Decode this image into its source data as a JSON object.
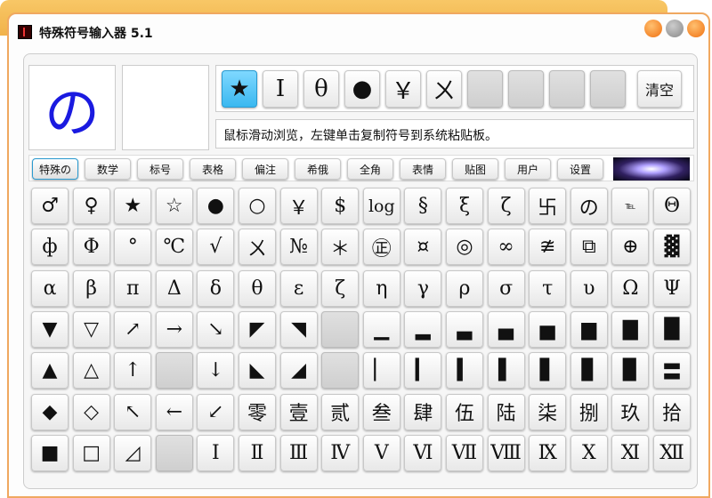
{
  "window": {
    "title": "特殊符号输入器 5.1"
  },
  "preview": {
    "symbol": "の"
  },
  "recent": [
    "★",
    "Ⅰ",
    "θ",
    "●",
    "￥",
    "ㄨ",
    "",
    "",
    "",
    ""
  ],
  "clear_label": "清空",
  "hint": "鼠标滑动浏览，左键单击复制符号到系统粘贴板。",
  "tabs": [
    "特殊の",
    "数学",
    "标号",
    "表格",
    "偏注",
    "希俄",
    "全角",
    "表情",
    "贴图",
    "用户",
    "设置"
  ],
  "grid": [
    [
      "♂",
      "♀",
      "★",
      "☆",
      "●",
      "○",
      "￥",
      "$",
      "log",
      "§",
      "ξ",
      "ζ",
      "卐",
      "の",
      "℡",
      "Θ"
    ],
    [
      "ф",
      "Φ",
      "°",
      "℃",
      "√",
      "ㄨ",
      "№",
      "＊",
      "㊣",
      "¤",
      "◎",
      "∞",
      "≇",
      "⧉",
      "⊕",
      "▓"
    ],
    [
      "α",
      "β",
      "π",
      "Δ",
      "δ",
      "θ",
      "ε",
      "ζ",
      "η",
      "γ",
      "ρ",
      "σ",
      "τ",
      "υ",
      "Ω",
      "Ψ"
    ],
    [
      "▼",
      "▽",
      "↗",
      "→",
      "↘",
      "◤",
      "◥",
      "",
      "▁",
      "▂",
      "▃",
      "▄",
      "▅",
      "▆",
      "▇",
      "█"
    ],
    [
      "▲",
      "△",
      "↑",
      "",
      "↓",
      "◣",
      "◢",
      "",
      "▏",
      "▎",
      "▍",
      "▌",
      "▋",
      "▊",
      "▉",
      "〓"
    ],
    [
      "◆",
      "◇",
      "↖",
      "←",
      "↙",
      "零",
      "壹",
      "贰",
      "叁",
      "肆",
      "伍",
      "陆",
      "柒",
      "捌",
      "玖",
      "拾"
    ],
    [
      "■",
      "□",
      "◿",
      "",
      "Ⅰ",
      "Ⅱ",
      "Ⅲ",
      "Ⅳ",
      "Ⅴ",
      "Ⅵ",
      "Ⅶ",
      "Ⅷ",
      "Ⅸ",
      "Ⅹ",
      "Ⅺ",
      "Ⅻ"
    ]
  ]
}
